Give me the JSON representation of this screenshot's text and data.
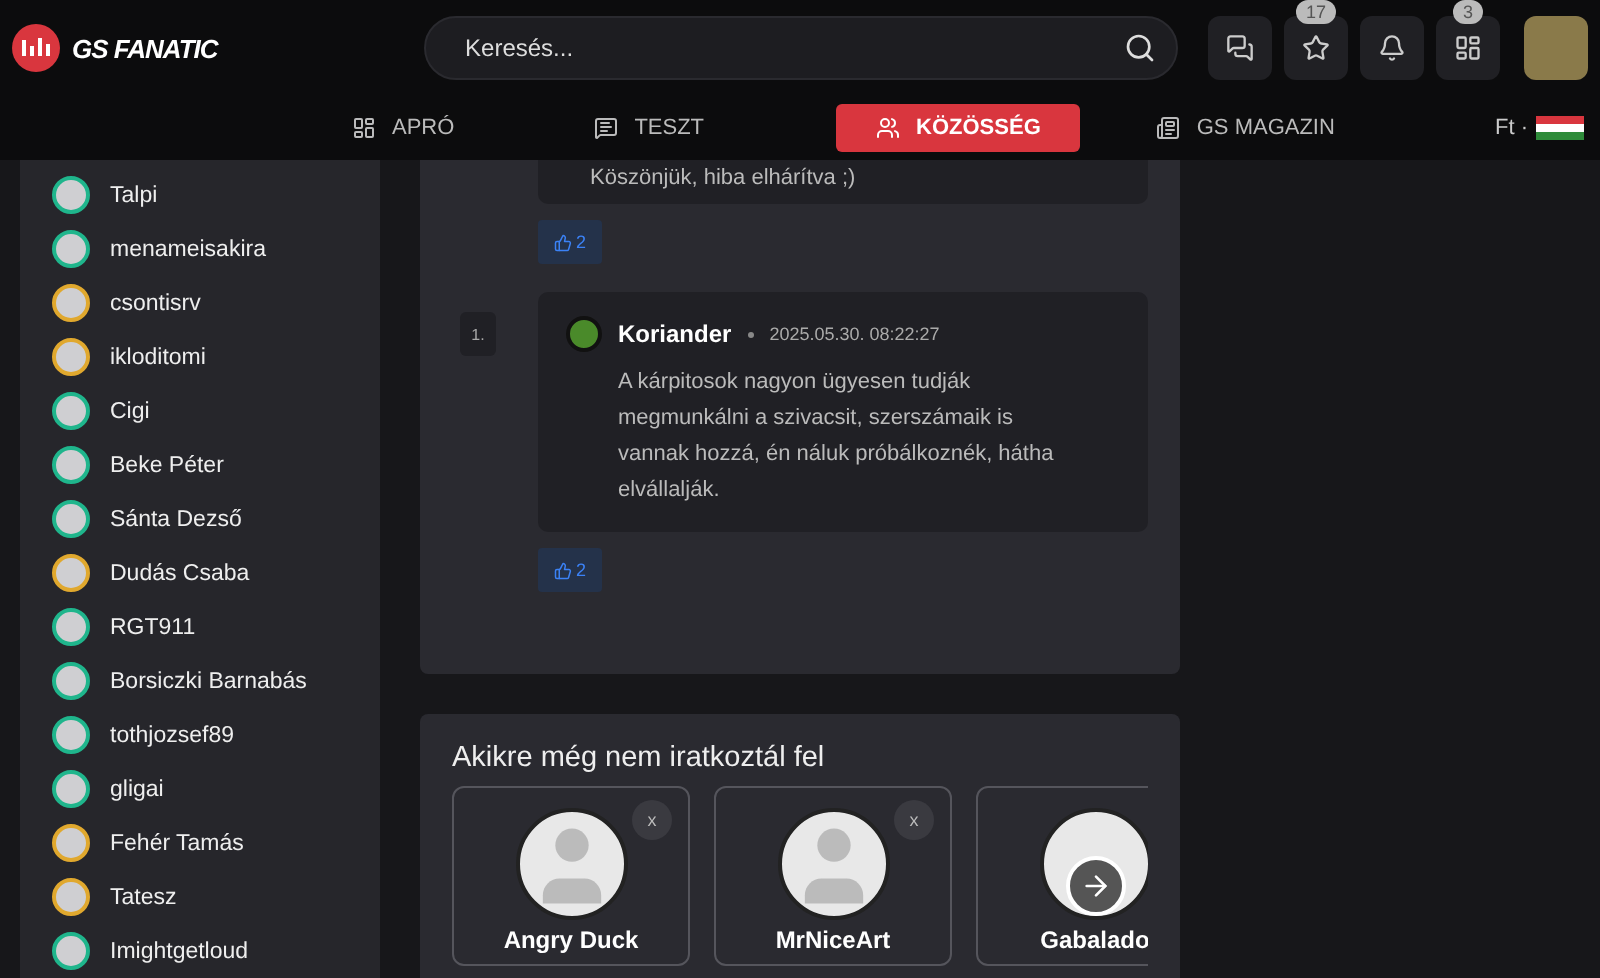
{
  "header": {
    "logo_text": "GS FANATIC",
    "search": {
      "placeholder": "Keresés..."
    },
    "icons": [
      {
        "kind": "chat"
      },
      {
        "kind": "star",
        "badge": "17"
      },
      {
        "kind": "bell"
      },
      {
        "kind": "layout",
        "badge": "3"
      }
    ]
  },
  "nav": {
    "items": [
      {
        "kind": "grid",
        "label": "APRÓ",
        "selected": false
      },
      {
        "kind": "test",
        "label": "TESZT",
        "selected": false
      },
      {
        "kind": "people",
        "label": "KÖZÖSSÉG",
        "selected": true
      },
      {
        "kind": "news",
        "label": "GS MAGAZIN",
        "selected": false
      }
    ],
    "currency": "Ft ·"
  },
  "sidebar": {
    "users": [
      {
        "name": "Talpi",
        "color": "#1fb58c"
      },
      {
        "name": "menameisakira",
        "color": "#1fb58c"
      },
      {
        "name": "csontisrv",
        "color": "#e0a82e"
      },
      {
        "name": "ikloditomi",
        "color": "#e0a82e"
      },
      {
        "name": "Cigi",
        "color": "#1fb58c"
      },
      {
        "name": "Beke Péter",
        "color": "#1fb58c"
      },
      {
        "name": "Sánta Dezső",
        "color": "#1fb58c"
      },
      {
        "name": "Dudás Csaba",
        "color": "#e0a82e"
      },
      {
        "name": "RGT911",
        "color": "#1fb58c"
      },
      {
        "name": "Borsiczki Barnabás",
        "color": "#1fb58c"
      },
      {
        "name": "tothjozsef89",
        "color": "#1fb58c"
      },
      {
        "name": "gligai",
        "color": "#1fb58c"
      },
      {
        "name": "Fehér Tamás",
        "color": "#e0a82e"
      },
      {
        "name": "Tatesz",
        "color": "#e0a82e"
      },
      {
        "name": "Imightgetloud",
        "color": "#1fb58c"
      }
    ]
  },
  "thread": {
    "prev_reply": {
      "text": "Köszönjük, hiba elhárítva ;)",
      "likes": "2"
    },
    "comment": {
      "number": "1.",
      "author": "Koriander",
      "time": "2025.05.30. 08:22:27",
      "text": "A kárpitosok nagyon ügyesen tudják megmunkálni a szivacsit, szerszámaik is vannak hozzá, én náluk próbálkoznék, hátha elvállalják.",
      "likes": "2"
    }
  },
  "suggestions": {
    "title": "Akikre még nem iratkoztál fel",
    "cards": [
      {
        "name": "Angry Duck",
        "close_label": "x"
      },
      {
        "name": "MrNiceArt",
        "close_label": "x"
      },
      {
        "name": "Gabalado"
      }
    ]
  }
}
